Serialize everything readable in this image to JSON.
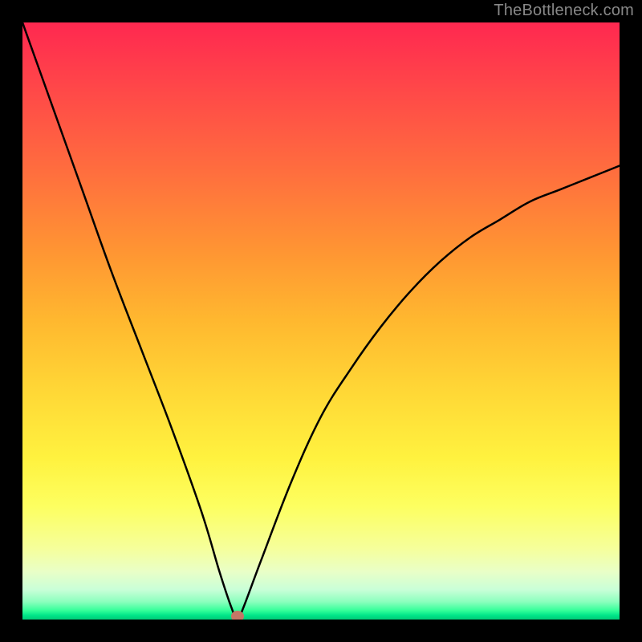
{
  "watermark": "TheBottleneck.com",
  "chart_data": {
    "type": "line",
    "title": "",
    "xlabel": "",
    "ylabel": "",
    "x": [
      0,
      5,
      10,
      15,
      20,
      25,
      30,
      33,
      35,
      36,
      37,
      40,
      45,
      50,
      55,
      60,
      65,
      70,
      75,
      80,
      85,
      90,
      95,
      100
    ],
    "values": [
      100,
      86,
      72,
      58,
      45,
      32,
      18,
      8,
      2,
      0,
      2,
      10,
      23,
      34,
      42,
      49,
      55,
      60,
      64,
      67,
      70,
      72,
      74,
      76
    ],
    "xlim": [
      0,
      100
    ],
    "ylim": [
      0,
      100
    ],
    "marker_point": {
      "x": 36,
      "y": 0
    },
    "background_gradient_stops": [
      {
        "pos": 0,
        "color": "#ff2850"
      },
      {
        "pos": 50,
        "color": "#ffd836"
      },
      {
        "pos": 88,
        "color": "#f6ff9a"
      },
      {
        "pos": 100,
        "color": "#00cc77"
      }
    ]
  },
  "plot_geometry": {
    "inner_left": 28,
    "inner_top": 28,
    "inner_width": 744,
    "inner_height": 744
  }
}
